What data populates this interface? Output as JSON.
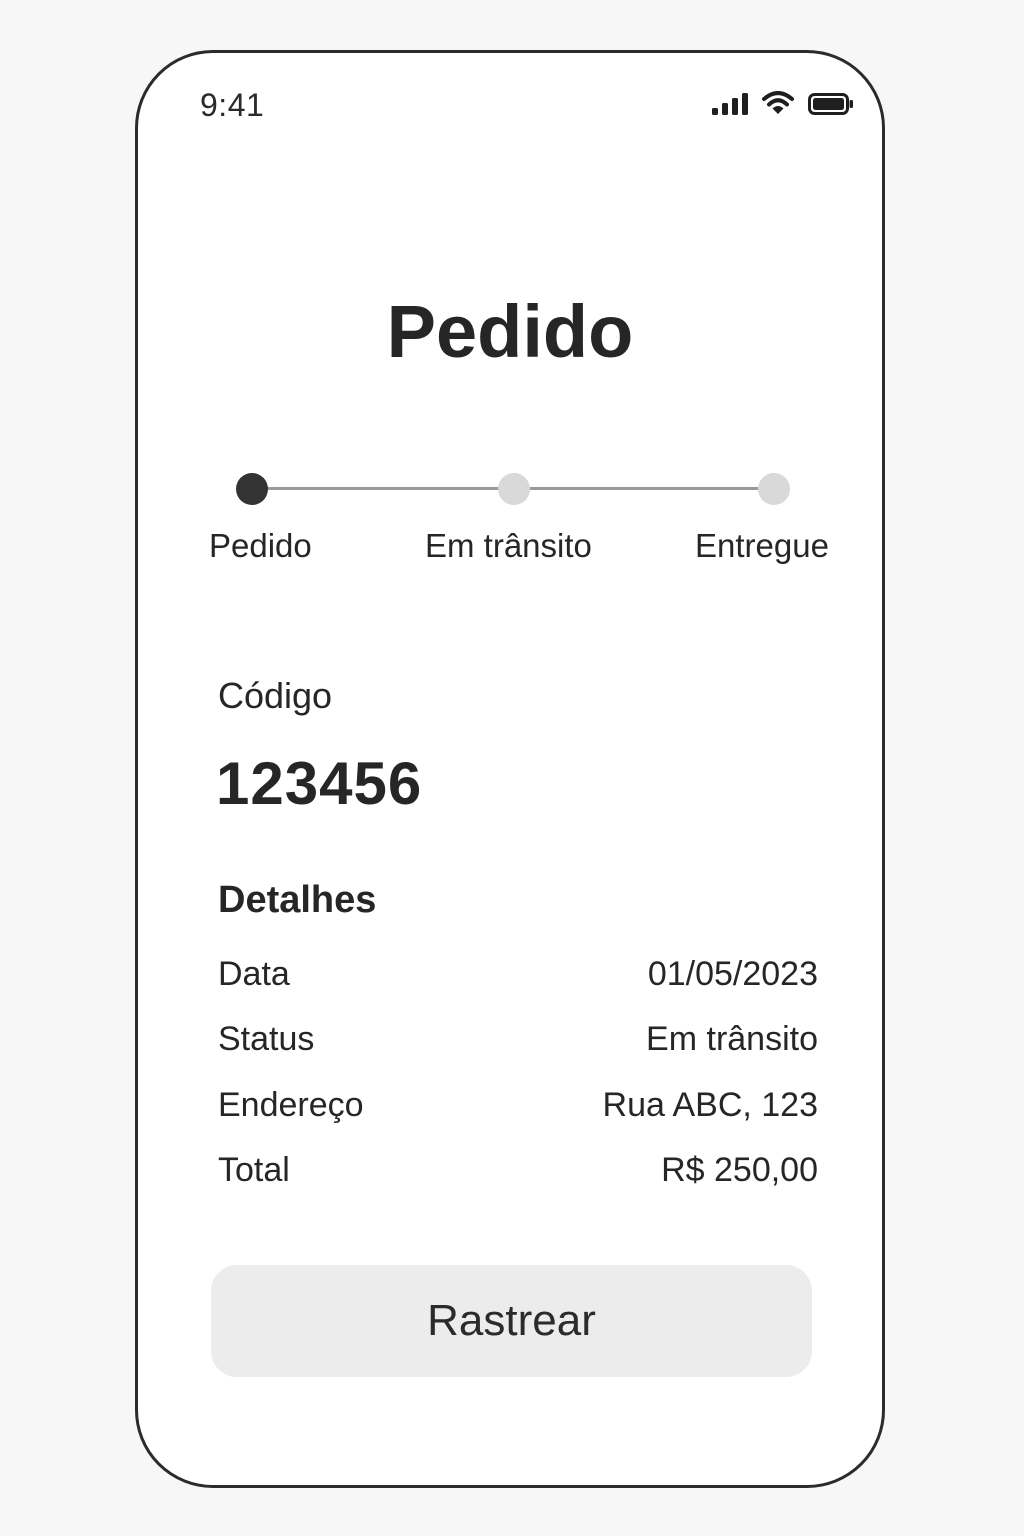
{
  "status_bar": {
    "time": "9:41",
    "icons": [
      "signal-icon",
      "wifi-icon",
      "battery-icon"
    ]
  },
  "title": "Pedido",
  "progress": {
    "steps": [
      {
        "label": "Pedido",
        "state": "active"
      },
      {
        "label": "Em trânsito",
        "state": "inactive"
      },
      {
        "label": "Entregue",
        "state": "inactive"
      }
    ]
  },
  "code": {
    "label": "Código",
    "value": "123456"
  },
  "details": {
    "heading": "Detalhes",
    "rows": [
      {
        "label": "Data",
        "value": "01/05/2023"
      },
      {
        "label": "Status",
        "value": "Em trânsito"
      },
      {
        "label": "Endereço",
        "value": "Rua ABC, 123"
      },
      {
        "label": "Total",
        "value": "R$ 250,00"
      }
    ]
  },
  "actions": {
    "track_label": "Rastrear"
  },
  "colors": {
    "active_step": "#333333",
    "inactive_step": "#d9d9d9",
    "button_bg": "#ececec"
  }
}
